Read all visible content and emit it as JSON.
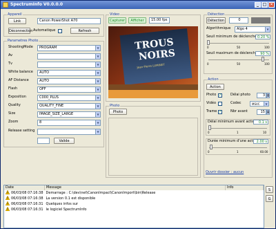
{
  "window": {
    "title": "SpectrumInfo V0.0.0.0"
  },
  "appareil": {
    "group_label": "Appareil",
    "link_button": "Link",
    "camera_name": "Canon PowerShot A70",
    "disconnect_button": "Déconnection",
    "auto_label": "Automatique",
    "refresh_button": "Refresh"
  },
  "params": {
    "group_label": "Parametres Photo",
    "rows": [
      {
        "label": "ShootingMode",
        "value": "PROGRAM"
      },
      {
        "label": "Av",
        "value": ""
      },
      {
        "label": "Tv",
        "value": ""
      },
      {
        "label": "White balance",
        "value": "AUTO"
      },
      {
        "label": "AF Distance",
        "value": "AUTO"
      },
      {
        "label": "Flash",
        "value": "OFF"
      },
      {
        "label": "Exposition",
        "value": "C000_PLUS"
      },
      {
        "label": "Quality",
        "value": "QUALITY_FINE"
      },
      {
        "label": "Size",
        "value": "IMAGE_SIZE_LARGE"
      },
      {
        "label": "Zoom",
        "value": "8"
      }
    ],
    "release_label": "Release setting",
    "validate_button": "Valide"
  },
  "video": {
    "group_label": "Video",
    "capture_button": "Capturer",
    "show_button": "Afficher",
    "fps": "15.00 fps",
    "image_text_line1": "TROUS",
    "image_text_line2": "NOIRS",
    "image_caption": "Jean-Pierre LUMINET"
  },
  "photo": {
    "group_label": "Photo",
    "photo_button": "Photo"
  },
  "detection": {
    "group_label": "Détection",
    "detect_button": "Détection",
    "count": "0",
    "algo_label": "Algorithmique",
    "algo_value": "Algo 4",
    "seuil_min_label": "Seuil minimum de déclenchement",
    "seuil_min_value": "0.20 %",
    "seuil_min_ticks": [
      "0",
      "50",
      "100"
    ],
    "seuil_max_label": "Seuil maximum de déclenchement",
    "seuil_max_value": "90 %",
    "seuil_max_ticks": [
      "0",
      "50",
      "100"
    ],
    "seuil_min_level": 0.2,
    "seuil_max_level": 90
  },
  "action": {
    "group_label": "Action",
    "action_button": "Action",
    "photo_label": "Photo",
    "video_label": "Vidéo",
    "trame_label": "Trame",
    "delai_photo_label": "Délai photo",
    "delai_photo_value": "3",
    "codec_label": "Codec",
    "codec_value": "MSVC",
    "nbr_avant_label": "Nbr avant",
    "nbr_avant_value": "15",
    "delai_min_label": "Délai minimum avant action",
    "delai_min_value": "0.1 s",
    "delai_min_ticks": [
      "0",
      "1",
      "10"
    ],
    "delai_min_level": 0.1,
    "duree_min_label": "Durée minimum d'une action",
    "duree_min_value": "2.00 s",
    "duree_min_ticks": [
      "0",
      "1",
      "60.00"
    ],
    "duree_min_level": 2.0,
    "folder_link": "Ouvrir dossier : aucun"
  },
  "log": {
    "columns": [
      "Date",
      "Message",
      "Info"
    ],
    "rows": [
      {
        "date": "06/03/08 07:16:38",
        "message": "Demarrage : C:\\dev\\net\\CanonImpact\\CanonImport\\bin\\Release",
        "info": ""
      },
      {
        "date": "06/03/08 07:16:38",
        "message": "La version 0.1 est disponible",
        "info": ""
      },
      {
        "date": "06/03/08 07:16:31",
        "message": "Quelques infos sur",
        "info": ""
      },
      {
        "date": "06/03/08 07:16:31",
        "message": "le logiciel SpectrumInfo",
        "info": ""
      }
    ],
    "side_buttons": [
      "S",
      "G"
    ]
  }
}
